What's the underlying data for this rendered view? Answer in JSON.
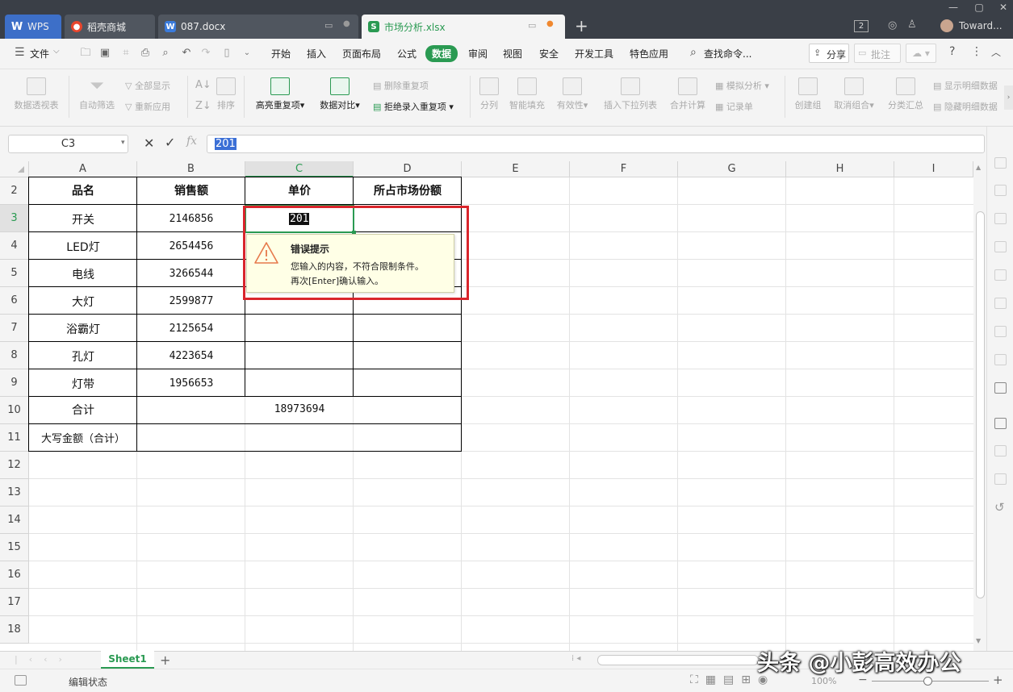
{
  "tabs": [
    {
      "label": "WPS",
      "icon": "wps-logo-icon"
    },
    {
      "label": "稻壳商城",
      "icon": "daoke-flame-icon"
    },
    {
      "label": "087.docx",
      "icon": "word-doc-icon"
    },
    {
      "label": "市场分析.xlsx",
      "icon": "spreadsheet-icon"
    }
  ],
  "title_badge": "2",
  "user_name": "Toward...",
  "menu": {
    "file": "文件",
    "items": [
      "开始",
      "插入",
      "页面布局",
      "公式",
      "数据",
      "审阅",
      "视图",
      "安全",
      "开发工具",
      "特色应用"
    ],
    "active": "数据",
    "search": "查找命令...",
    "share": "分享",
    "annotate": "批注"
  },
  "ribbon": {
    "pivot": "数据透视表",
    "autofilter": "自动筛选",
    "show_all": "全部显示",
    "reapply": "重新应用",
    "sort": "排序",
    "highlight_dup": "高亮重复项",
    "data_compare": "数据对比",
    "remove_dup": "删除重复项",
    "reject_dup": "拒绝录入重复项",
    "split": "分列",
    "smart_fill": "智能填充",
    "validity": "有效性",
    "insert_dropdown": "插入下拉列表",
    "consolidate": "合并计算",
    "simulate": "模拟分析",
    "record": "记录单",
    "create_group": "创建组",
    "ungroup": "取消组合",
    "subtotal": "分类汇总",
    "show_detail": "显示明细数据",
    "hide_detail": "隐藏明细数据"
  },
  "formula_bar": {
    "name_box": "C3",
    "fx": "fx",
    "value": "201"
  },
  "columns": [
    "A",
    "B",
    "C",
    "D",
    "E",
    "F",
    "G",
    "H",
    "I"
  ],
  "rows": [
    "2",
    "3",
    "4",
    "5",
    "6",
    "7",
    "8",
    "9",
    "10",
    "11",
    "12",
    "13",
    "14",
    "15",
    "16",
    "17",
    "18"
  ],
  "table": {
    "headers": [
      "品名",
      "销售额",
      "单价",
      "所占市场份额"
    ],
    "data": [
      {
        "name": "开关",
        "sales": "2146856",
        "price": "201",
        "share": ""
      },
      {
        "name": "LED灯",
        "sales": "2654456",
        "price": "",
        "share": ""
      },
      {
        "name": "电线",
        "sales": "3266544",
        "price": "",
        "share": ""
      },
      {
        "name": "大灯",
        "sales": "2599877",
        "price": "",
        "share": ""
      },
      {
        "name": "浴霸灯",
        "sales": "2125654",
        "price": "",
        "share": ""
      },
      {
        "name": "孔灯",
        "sales": "4223654",
        "price": "",
        "share": ""
      },
      {
        "name": "灯带",
        "sales": "1956653",
        "price": "",
        "share": ""
      }
    ],
    "total_label": "合计",
    "total_value": "18973694",
    "caps_label": "大写金额（合计）"
  },
  "error_popup": {
    "title": "错误提示",
    "line1": "您输入的内容，不符合限制条件。",
    "line2": "再次[Enter]确认输入。"
  },
  "sheet_tab": "Sheet1",
  "status": {
    "mode": "编辑状态",
    "zoom": "100%"
  },
  "watermark": "头条 @小彭高效办公",
  "colors": {
    "accent": "#2a9a52",
    "highlight_border": "#d9252c",
    "popup_bg": "#ffffe6",
    "tabbar": "#3a3f47"
  }
}
